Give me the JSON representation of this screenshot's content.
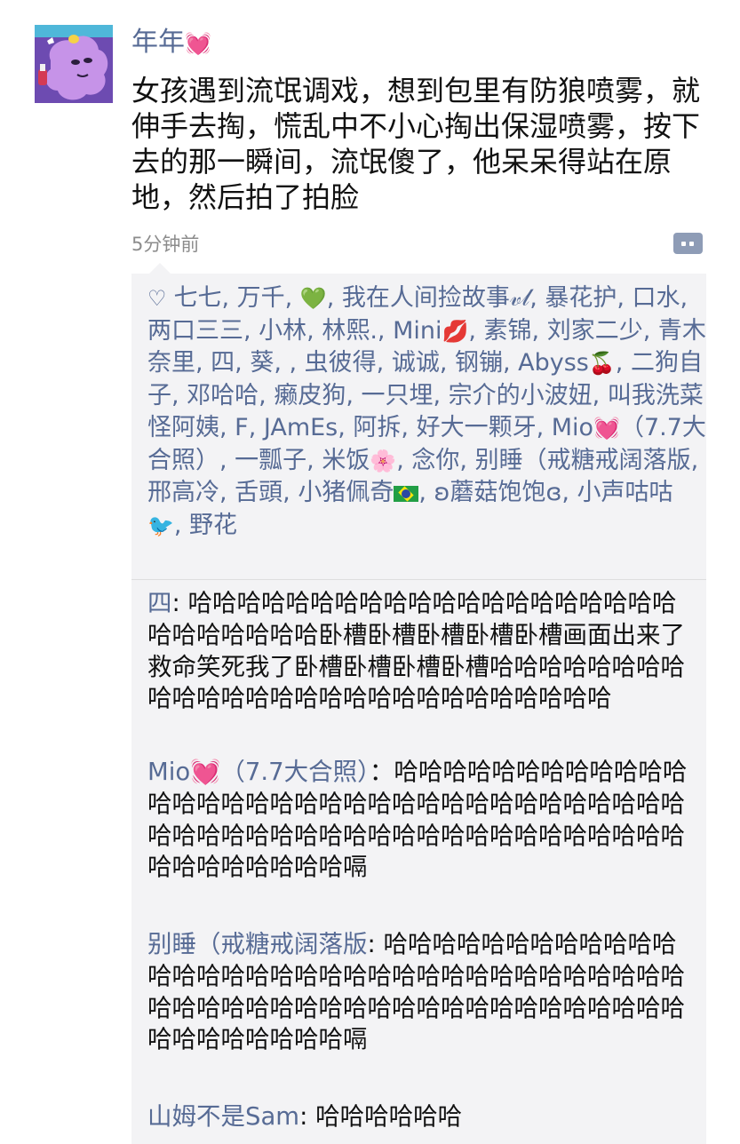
{
  "post": {
    "username": "年年",
    "username_emoji": "💓",
    "text": "女孩遇到流氓调戏，想到包里有防狼喷雾，就伸手去掏，慌乱中不小心掏出保湿喷雾，按下去的那一瞬间，流氓傻了，他呆呆得站在原地，然后拍了拍脸",
    "time": "5分钟前"
  },
  "likes": {
    "icon": "heart-outline-icon",
    "segments": [
      {
        "text": "七七, 万千, "
      },
      {
        "emoji": "💚"
      },
      {
        "text": ", 我在人间捡故事𝓋𝓁, 暴花护, 口水, 两口三三, 小林, 林熙., Mini"
      },
      {
        "emoji": "💋"
      },
      {
        "text": ", 素锦, 刘家二少, 青木奈里, 四, 葵, , 虫彼得, 诚诚, 钢镚, Abyss"
      },
      {
        "emoji": "🍒"
      },
      {
        "text": ", 二狗自子, 邓哈哈, 癞皮狗, 一只埋, 宗介的小波妞, 叫我洗菜怪阿姨, F, JAmEs, 阿拆, 好大一颗牙, Mio"
      },
      {
        "emoji": "💓"
      },
      {
        "text": "（7.7大合照）, 一瓢子, 米饭"
      },
      {
        "emoji": "🌸"
      },
      {
        "text": ", 念你, 别睡（戒糖戒阔落版, 邢高冷, 舌頭, 小猪佩奇"
      },
      {
        "flag": "brazil-flag-icon"
      },
      {
        "text": ", ʚ蘑菇饱饱ɞ, 小声咕咕"
      },
      {
        "emoji": "🐦"
      },
      {
        "text": ", 野花"
      }
    ]
  },
  "comments": [
    {
      "name": "四",
      "sep": ": ",
      "text": "哈哈哈哈哈哈哈哈哈哈哈哈哈哈哈哈哈哈哈哈哈哈哈哈哈哈哈卧槽卧槽卧槽卧槽卧槽画面出来了救命笑死我了卧槽卧槽卧槽卧槽哈哈哈哈哈哈哈哈哈哈哈哈哈哈哈哈哈哈哈哈哈哈哈哈哈哈哈"
    },
    {
      "name": "Mio💓（7.7大合照）",
      "sep": "：",
      "text": "哈哈哈哈哈哈哈哈哈哈哈哈哈哈哈哈哈哈哈哈哈哈哈哈哈哈哈哈哈哈哈哈哈哈哈哈哈哈哈哈哈哈哈哈哈哈哈哈哈哈哈哈哈哈哈哈哈哈哈哈哈哈哈哈嗝"
    },
    {
      "name": "别睡（戒糖戒阔落版",
      "sep": ": ",
      "text": "哈哈哈哈哈哈哈哈哈哈哈哈哈哈哈哈哈哈哈哈哈哈哈哈哈哈哈哈哈哈哈哈哈哈哈哈哈哈哈哈哈哈哈哈哈哈哈哈哈哈哈哈哈哈哈哈哈哈哈哈哈哈哈哈嗝"
    },
    {
      "name": "山姆不是Sam",
      "sep": ": ",
      "text": "哈哈哈哈哈哈"
    }
  ],
  "colors": {
    "link": "#576b95",
    "text": "#111111",
    "panel": "#f3f3f5",
    "time": "#8c8c8c"
  }
}
